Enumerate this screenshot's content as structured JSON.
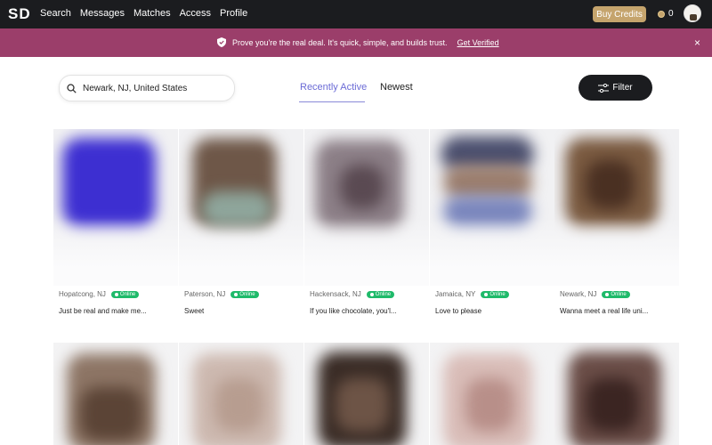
{
  "nav": {
    "logo": "SD",
    "items": [
      "Search",
      "Messages",
      "Matches",
      "Access",
      "Profile"
    ],
    "buy_credits": "Buy Credits",
    "credits_count": "0"
  },
  "banner": {
    "message": "Prove you're the real deal. It's quick, simple, and builds trust.",
    "link": "Get Verified",
    "close": "×"
  },
  "search": {
    "value": "Newark, NJ, United States"
  },
  "tabs": {
    "active": "Recently Active",
    "other": "Newest"
  },
  "filter": {
    "label": "Filter"
  },
  "profiles": [
    {
      "city": "Hopatcong, NJ",
      "status": "Online",
      "tagline": "Just be real and make me..."
    },
    {
      "city": "Paterson, NJ",
      "status": "Online",
      "tagline": "Sweet"
    },
    {
      "city": "Hackensack, NJ",
      "status": "Online",
      "tagline": "If you like chocolate, you'l..."
    },
    {
      "city": "Jamaica, NY",
      "status": "Online",
      "tagline": "Love to please"
    },
    {
      "city": "Newark, NJ",
      "status": "Online",
      "tagline": "Wanna meet a real life uni..."
    }
  ],
  "colors": {
    "banner": "#9b3e6a",
    "accent_tab": "#6b6bd6",
    "online": "#1fba6a",
    "buy_credits": "#c5a46d"
  }
}
